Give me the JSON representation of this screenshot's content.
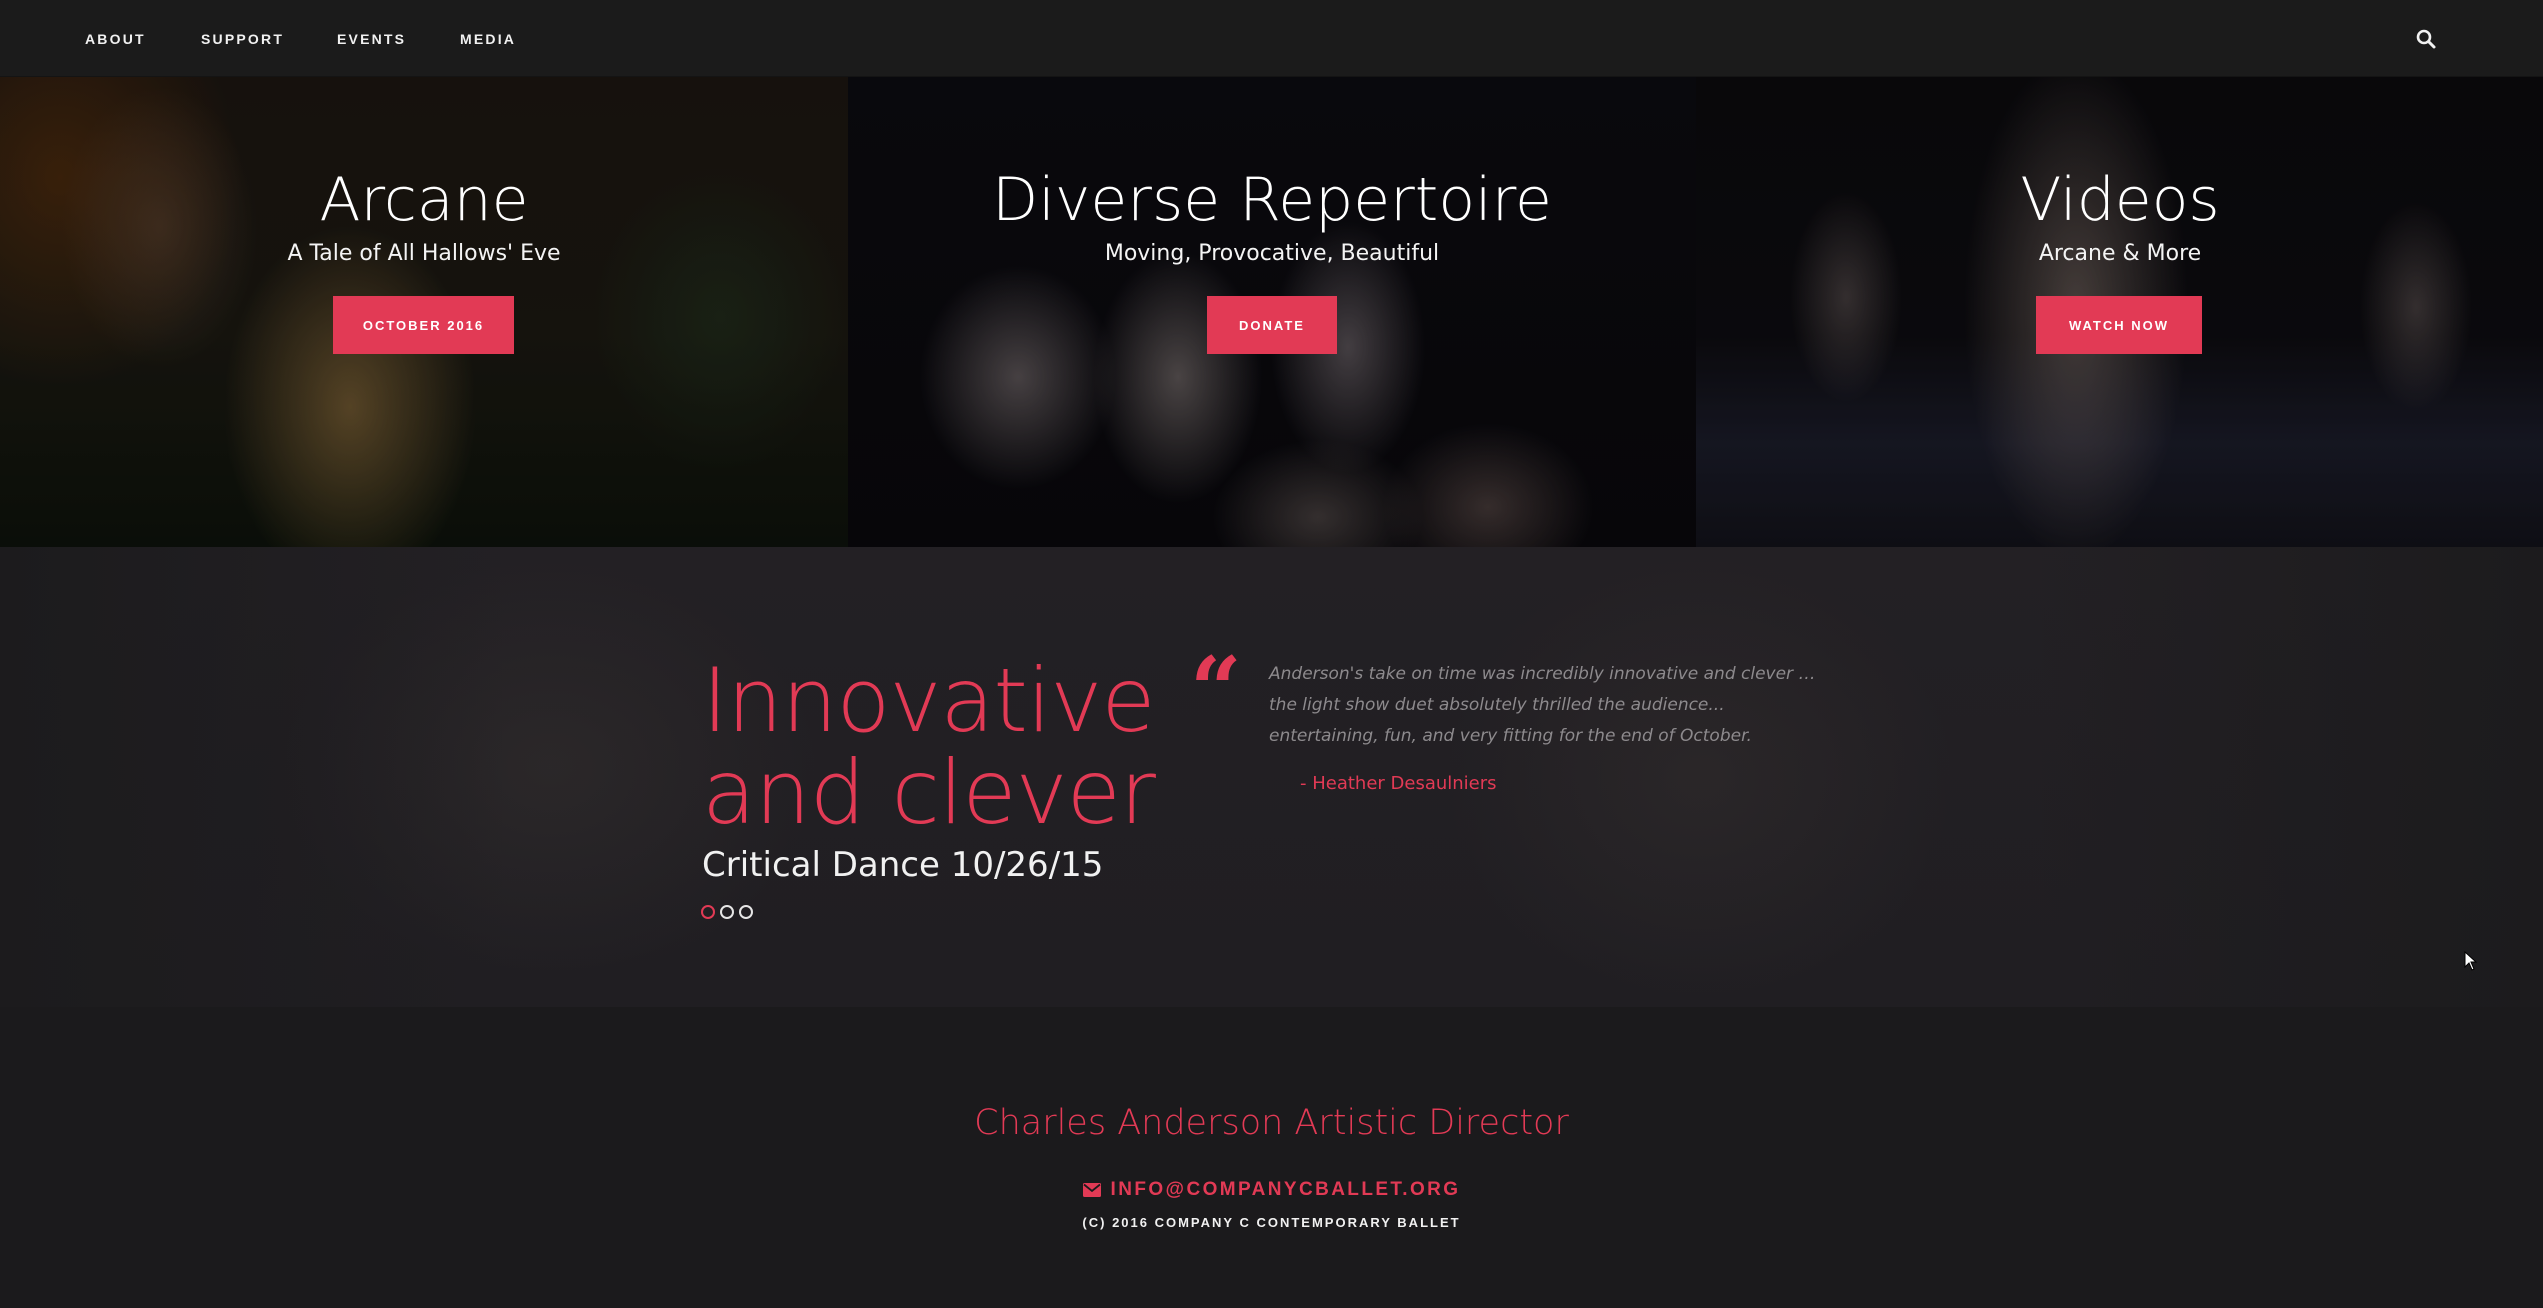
{
  "nav": {
    "items": [
      {
        "label": "ABOUT"
      },
      {
        "label": "SUPPORT"
      },
      {
        "label": "EVENTS"
      },
      {
        "label": "MEDIA"
      }
    ],
    "search_icon": "search-icon"
  },
  "hero": {
    "panels": [
      {
        "title": "Arcane",
        "subtitle": "A Tale of All Hallows' Eve",
        "button": "OCTOBER 2016"
      },
      {
        "title": "Diverse Repertoire",
        "subtitle": "Moving, Provocative, Beautiful",
        "button": "DONATE"
      },
      {
        "title": "Videos",
        "subtitle": "Arcane & More",
        "button": "WATCH NOW"
      }
    ]
  },
  "testimonial": {
    "headline": "Innovative and clever",
    "source": "Critical Dance 10/26/15",
    "quote": "Anderson's take on time was incredibly innovative and clever … the light show duet absolutely thrilled the audience... entertaining, fun, and very fitting for the end of October.",
    "author": "- Heather Desaulniers",
    "slides": 3,
    "active_slide": 1
  },
  "footer": {
    "director": "Charles Anderson Artistic Director",
    "email": "INFO@COMPANYCBALLET.ORG",
    "email_icon": "envelope-icon",
    "copyright": "(C) 2016 COMPANY C CONTEMPORARY BALLET"
  },
  "colors": {
    "accent": "#e23a55",
    "nav_bg": "#1b1b1b",
    "page_bg": "#1b1a1c"
  }
}
